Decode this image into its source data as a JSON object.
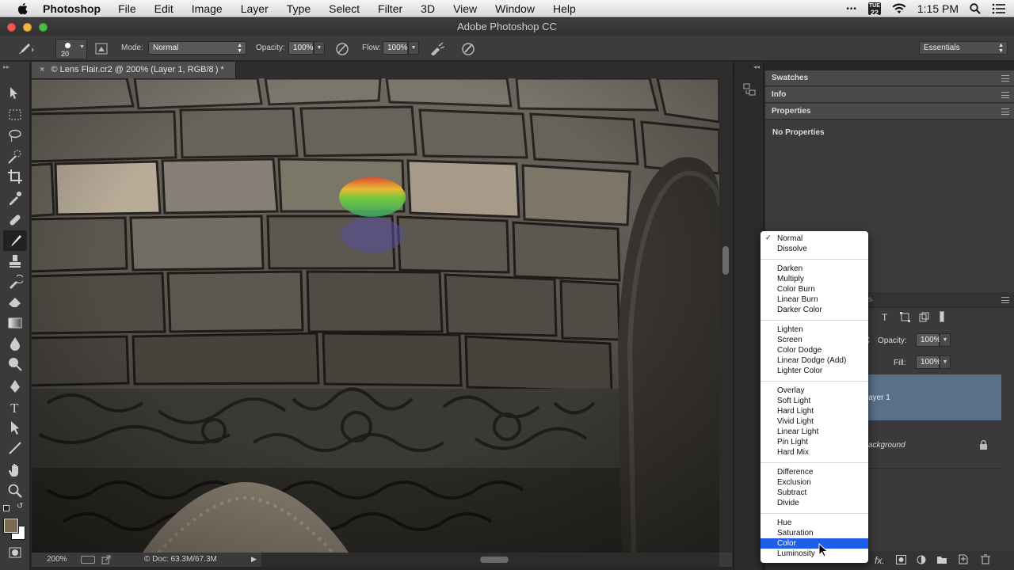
{
  "menubar": {
    "app_name": "Photoshop",
    "items": [
      "File",
      "Edit",
      "Image",
      "Layer",
      "Type",
      "Select",
      "Filter",
      "3D",
      "View",
      "Window",
      "Help"
    ],
    "more": "•••",
    "date_badge_day": "TUE",
    "date_badge_num": "22",
    "clock": "1:15 PM"
  },
  "window": {
    "title": "Adobe Photoshop CC"
  },
  "options_bar": {
    "brush_size": "20",
    "mode_label": "Mode:",
    "mode_value": "Normal",
    "opacity_label": "Opacity:",
    "opacity_value": "100%",
    "flow_label": "Flow:",
    "flow_value": "100%",
    "workspace": "Essentials"
  },
  "document": {
    "close": "×",
    "tab_title": "© Lens Flair.cr2 @ 200% (Layer 1, RGB/8 ) *",
    "zoom": "200%",
    "doc_info": "© Doc: 63.3M/67.3M"
  },
  "panels": {
    "swatches": "Swatches",
    "info": "Info",
    "properties": "Properties",
    "no_properties": "No Properties",
    "layers_opacity_label": "Opacity:",
    "layers_opacity_value": "100%",
    "layers_fill_label": "Fill:",
    "layers_fill_value": "100%",
    "layer1_partial": "ayer 1",
    "background_partial": "ackground",
    "layers_tab_partial": "s",
    "fx_label": "fx."
  },
  "blend_menu": {
    "checked": "✓",
    "selected": "Color",
    "groups": [
      [
        "Normal",
        "Dissolve"
      ],
      [
        "Darken",
        "Multiply",
        "Color Burn",
        "Linear Burn",
        "Darker Color"
      ],
      [
        "Lighten",
        "Screen",
        "Color Dodge",
        "Linear Dodge (Add)",
        "Lighter Color"
      ],
      [
        "Overlay",
        "Soft Light",
        "Hard Light",
        "Vivid Light",
        "Linear Light",
        "Pin Light",
        "Hard Mix"
      ],
      [
        "Difference",
        "Exclusion",
        "Subtract",
        "Divide"
      ],
      [
        "Hue",
        "Saturation",
        "Color",
        "Luminosity"
      ]
    ]
  },
  "colors": {
    "selection": "#1d5fe6",
    "foreground_swatch": "#7a6a52",
    "background_swatch": "#ffffff",
    "layer_selected": "#5a7089"
  }
}
